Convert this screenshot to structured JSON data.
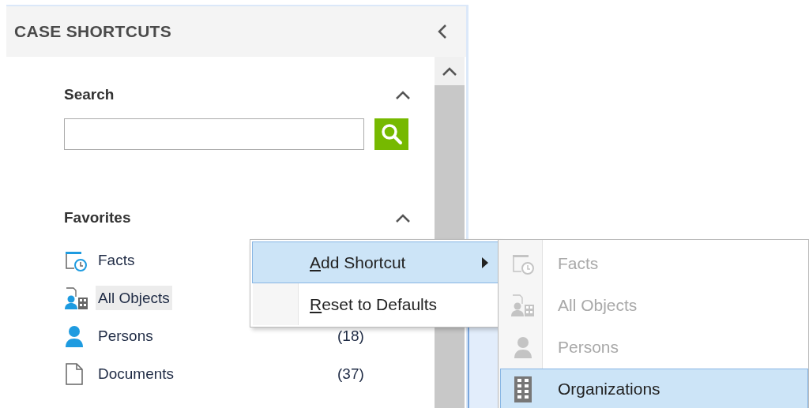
{
  "panel": {
    "title": "CASE SHORTCUTS"
  },
  "search": {
    "title": "Search",
    "expanded": true
  },
  "favorites": {
    "title": "Favorites",
    "expanded": true,
    "items": [
      {
        "kind": "facts",
        "label": "Facts",
        "selected": false
      },
      {
        "kind": "all-objects",
        "label": "All Objects",
        "selected": true
      },
      {
        "kind": "persons",
        "label": "Persons",
        "count": "(18)",
        "selected": false
      },
      {
        "kind": "documents",
        "label": "Documents",
        "count": "(37)",
        "selected": false
      }
    ]
  },
  "context_menu": {
    "items": [
      {
        "label": "Add Shortcut",
        "mnemonic": true,
        "submenu": true,
        "selected": true
      },
      {
        "label": "Reset to Defaults",
        "mnemonic": true,
        "submenu": false,
        "selected": false
      }
    ]
  },
  "submenu": {
    "items": [
      {
        "kind": "facts",
        "label": "Facts",
        "disabled": true,
        "selected": false
      },
      {
        "kind": "all-objects",
        "label": "All Objects",
        "disabled": true,
        "selected": false
      },
      {
        "kind": "persons",
        "label": "Persons",
        "disabled": true,
        "selected": false
      },
      {
        "kind": "organizations",
        "label": "Organizations",
        "disabled": false,
        "selected": true
      }
    ]
  }
}
